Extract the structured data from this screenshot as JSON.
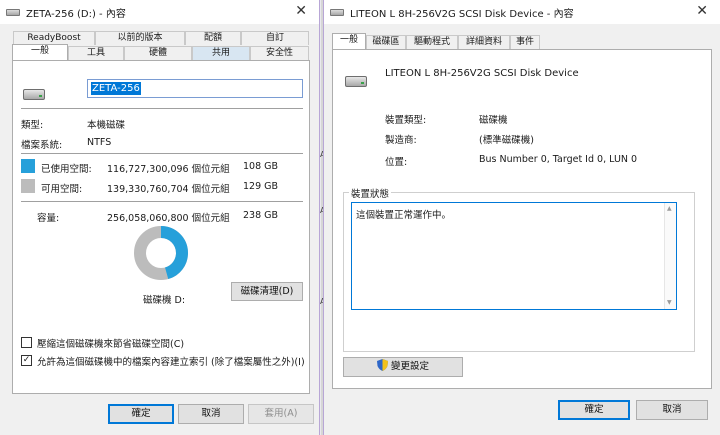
{
  "left_window": {
    "title": "ZETA-256 (D:) - 內容",
    "close_glyph": "✕",
    "tabs_row1": [
      "ReadyBoost",
      "以前的版本",
      "配額",
      "自訂"
    ],
    "tabs_row2": [
      "一般",
      "工具",
      "硬體",
      "共用",
      "安全性"
    ],
    "volume_name": "ZETA-256",
    "type_label": "類型:",
    "type_value": "本機磁碟",
    "fs_label": "檔案系統:",
    "fs_value": "NTFS",
    "used_label": "已使用空間:",
    "used_bytes": "116,727,300,096 個位元組",
    "used_gb": "108 GB",
    "free_label": "可用空間:",
    "free_bytes": "139,330,760,704 個位元組",
    "free_gb": "129 GB",
    "capacity_label": "容量:",
    "capacity_bytes": "256,058,060,800 個位元組",
    "capacity_gb": "238 GB",
    "drive_caption": "磁碟機 D:",
    "cleanup_button": "磁碟清理(D)",
    "compress_label": "壓縮這個磁碟機來節省磁碟空間(C)",
    "compress_checked": false,
    "index_label": "允許為這個磁碟機中的檔案內容建立索引 (除了檔案屬性之外)(I)",
    "index_checked": true,
    "ok": "確定",
    "cancel": "取消",
    "apply": "套用(A)",
    "used_fraction": 0.4559,
    "colors": {
      "used": "#26a0da",
      "free": "#bcbcbc"
    }
  },
  "right_window": {
    "title": "LITEON L 8H-256V2G SCSI Disk Device - 內容",
    "close_glyph": "✕",
    "tabs": [
      "一般",
      "磁碟區",
      "驅動程式",
      "詳細資料",
      "事件"
    ],
    "device_name": "LITEON L 8H-256V2G SCSI Disk Device",
    "device_type_label": "裝置類型:",
    "device_type_value": "磁碟機",
    "manufacturer_label": "製造商:",
    "manufacturer_value": "(標準磁碟機)",
    "location_label": "位置:",
    "location_value": "Bus Number 0, Target Id 0, LUN 0",
    "status_group_label": "裝置狀態",
    "status_text": "這個裝置正常運作中。",
    "change_settings": "變更設定",
    "ok": "確定",
    "cancel": "取消"
  },
  "edge_letters": [
    "A",
    "A",
    "A"
  ]
}
